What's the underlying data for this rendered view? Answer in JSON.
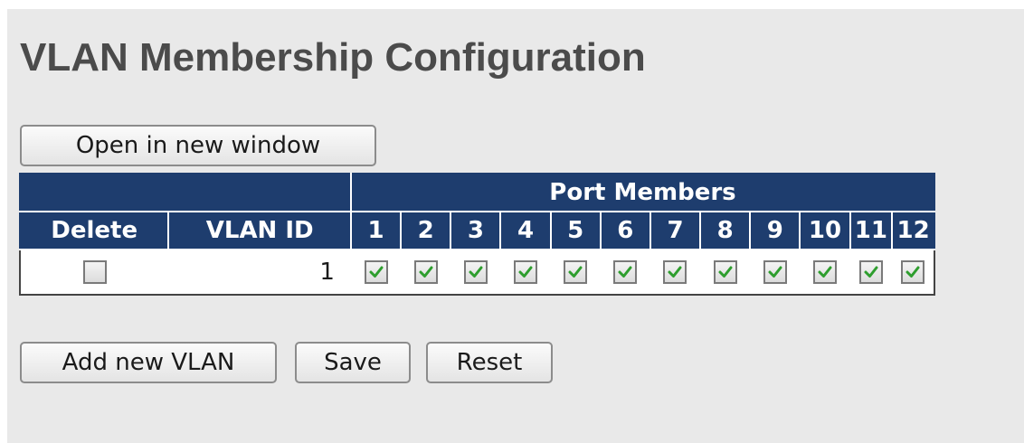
{
  "page_title": "VLAN Membership Configuration",
  "buttons": {
    "open_new_window": "Open in new window",
    "add_new_vlan": "Add new VLAN",
    "save": "Save",
    "reset": "Reset"
  },
  "table": {
    "group_header": "Port Members",
    "delete_header": "Delete",
    "vlan_id_header": "VLAN ID",
    "ports": [
      "1",
      "2",
      "3",
      "4",
      "5",
      "6",
      "7",
      "8",
      "9",
      "10",
      "11",
      "12"
    ],
    "rows": [
      {
        "delete_checked": false,
        "vlan_id": "1",
        "members": [
          true,
          true,
          true,
          true,
          true,
          true,
          true,
          true,
          true,
          true,
          true,
          true
        ]
      }
    ]
  },
  "colors": {
    "header_bg": "#1e3d6e",
    "check_mark": "#2e9e2e",
    "title": "#4b4b4b",
    "panel_bg": "#e9e9e9"
  },
  "icons": {
    "checked": "green-checkmark-icon",
    "unchecked": "empty-checkbox"
  }
}
